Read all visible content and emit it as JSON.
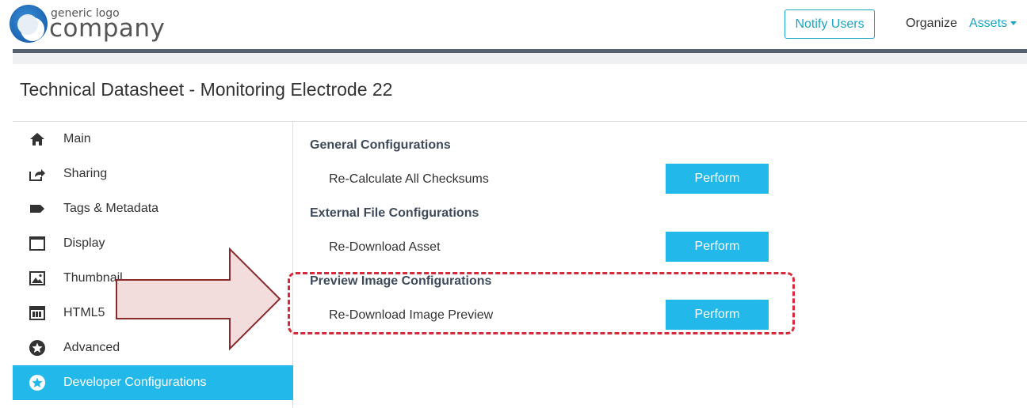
{
  "header": {
    "logo_small": "generic logo",
    "logo_big": "company",
    "notify_label": "Notify Users",
    "organize_label": "Organize",
    "assets_label": "Assets"
  },
  "page": {
    "title": "Technical Datasheet - Monitoring Electrode 22"
  },
  "sidebar": {
    "items": [
      {
        "label": "Main",
        "icon": "home-icon"
      },
      {
        "label": "Sharing",
        "icon": "share-icon"
      },
      {
        "label": "Tags & Metadata",
        "icon": "tag-icon"
      },
      {
        "label": "Display",
        "icon": "display-icon"
      },
      {
        "label": "Thumbnail",
        "icon": "image-icon"
      },
      {
        "label": "HTML5",
        "icon": "html5-icon"
      },
      {
        "label": "Advanced",
        "icon": "star-circle-icon"
      },
      {
        "label": "Developer Configurations",
        "icon": "star-circle-icon",
        "active": true
      }
    ]
  },
  "content": {
    "sections": [
      {
        "title": "General Configurations",
        "row_label": "Re-Calculate All Checksums",
        "button": "Perform"
      },
      {
        "title": "External File Configurations",
        "row_label": "Re-Download Asset",
        "button": "Perform"
      },
      {
        "title": "Preview Image Configurations",
        "row_label": "Re-Download Image Preview",
        "button": "Perform"
      }
    ]
  },
  "colors": {
    "accent": "#22b8ea",
    "header_rule": "#56606e",
    "annotation_red": "#d42a3a",
    "arrow_fill": "#f2dcdc",
    "arrow_stroke": "#8b2a2a"
  }
}
